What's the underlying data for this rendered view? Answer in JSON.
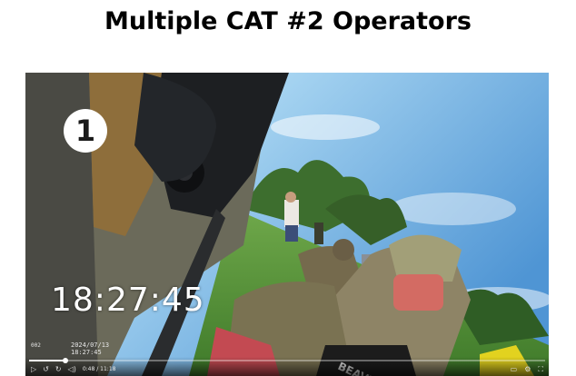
{
  "slide": {
    "title": "Multiple CAT #2 Operators"
  },
  "video": {
    "badge_number": "1",
    "clock_overlay": "18:27:45",
    "camera_id": "002",
    "camera_date": "2024/07/13",
    "camera_time": "18:27:45",
    "player": {
      "elapsed": "0:48",
      "duration": "11:18",
      "progress_fraction": 0.071
    }
  },
  "icons": {
    "play": "play-icon",
    "skip_back": "skip-back-icon",
    "skip_forward": "skip-forward-icon",
    "volume": "volume-icon",
    "captions": "captions-icon",
    "settings": "settings-icon",
    "fullscreen": "fullscreen-icon"
  }
}
